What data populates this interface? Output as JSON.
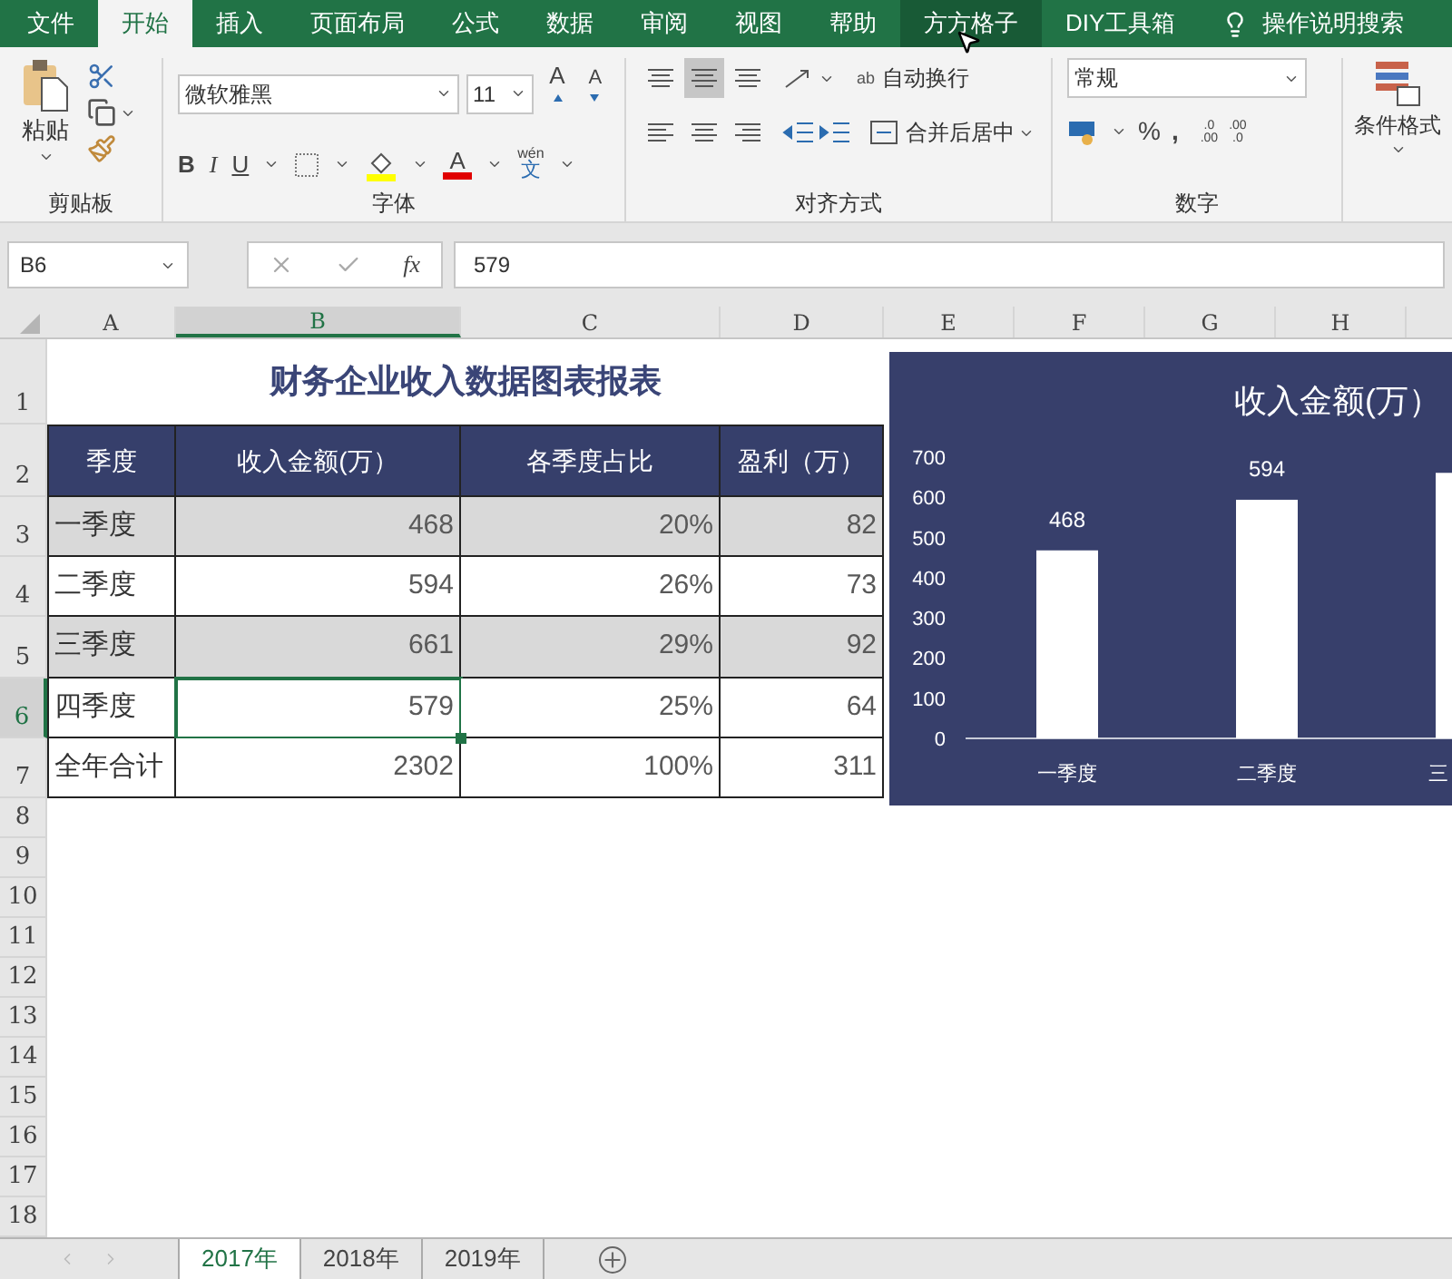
{
  "menu_tabs": [
    {
      "kind": "tab",
      "label": "文件",
      "selected": false,
      "hovered": false
    },
    {
      "kind": "tab",
      "label": "开始",
      "selected": true,
      "hovered": false
    },
    {
      "kind": "tab",
      "label": "插入",
      "selected": false,
      "hovered": false
    },
    {
      "kind": "tab",
      "label": "页面布局",
      "selected": false,
      "hovered": false
    },
    {
      "kind": "tab",
      "label": "公式",
      "selected": false,
      "hovered": false
    },
    {
      "kind": "tab",
      "label": "数据",
      "selected": false,
      "hovered": false
    },
    {
      "kind": "tab",
      "label": "审阅",
      "selected": false,
      "hovered": false
    },
    {
      "kind": "tab",
      "label": "视图",
      "selected": false,
      "hovered": false
    },
    {
      "kind": "tab",
      "label": "帮助",
      "selected": false,
      "hovered": false
    },
    {
      "kind": "tab",
      "label": "方方格子",
      "selected": false,
      "hovered": true
    },
    {
      "kind": "tab",
      "label": "DIY工具箱",
      "selected": false,
      "hovered": false
    },
    {
      "kind": "search",
      "label": "操作说明搜索",
      "selected": false,
      "hovered": false
    }
  ],
  "ribbon": {
    "clipboard": {
      "label": "剪贴板",
      "paste": "粘贴"
    },
    "font": {
      "label": "字体",
      "font_name": "微软雅黑",
      "font_size": "11",
      "grow": "A",
      "shrink": "A",
      "bold": "B",
      "italic": "I",
      "underline": "U",
      "font_color": "A",
      "phonetic_top": "wén",
      "phonetic_bottom": "文"
    },
    "alignment": {
      "label": "对齐方式",
      "vertical": [
        {
          "selected": false
        },
        {
          "selected": true
        },
        {
          "selected": false
        }
      ],
      "horizontal": [
        {
          "selected": false
        },
        {
          "selected": false
        },
        {
          "selected": false
        }
      ],
      "wrap_text": "自动换行",
      "wrap_glyph": "ab",
      "merge_center": "合并后居中"
    },
    "number": {
      "label": "数字",
      "format": "常规",
      "percent": "%",
      "comma": ",",
      "decimal_increase": [
        ".0",
        ".00"
      ],
      "decimal_decrease": [
        ".00",
        ".0"
      ]
    },
    "styles": {
      "conditional_format": "条件格式"
    }
  },
  "formula_bar": {
    "name_box": "B6",
    "fx": "fx",
    "value": "579"
  },
  "columns": [
    {
      "label": "A",
      "selected": false
    },
    {
      "label": "B",
      "selected": true
    },
    {
      "label": "C",
      "selected": false
    },
    {
      "label": "D",
      "selected": false
    },
    {
      "label": "E",
      "selected": false
    },
    {
      "label": "F",
      "selected": false
    },
    {
      "label": "G",
      "selected": false
    },
    {
      "label": "H",
      "selected": false
    }
  ],
  "row_headers": [
    {
      "label": "1",
      "selected": false
    },
    {
      "label": "2",
      "selected": false
    },
    {
      "label": "3",
      "selected": false
    },
    {
      "label": "4",
      "selected": false
    },
    {
      "label": "5",
      "selected": false
    },
    {
      "label": "6",
      "selected": true
    },
    {
      "label": "7",
      "selected": false
    },
    {
      "label": "8",
      "selected": false
    },
    {
      "label": "9",
      "selected": false
    },
    {
      "label": "10",
      "selected": false
    },
    {
      "label": "11",
      "selected": false
    },
    {
      "label": "12",
      "selected": false
    },
    {
      "label": "13",
      "selected": false
    },
    {
      "label": "14",
      "selected": false
    },
    {
      "label": "15",
      "selected": false
    },
    {
      "label": "16",
      "selected": false
    },
    {
      "label": "17",
      "selected": false
    },
    {
      "label": "18",
      "selected": false
    }
  ],
  "sheet": {
    "title": "财务企业收入数据图表报表",
    "header": [
      "季度",
      "收入金额(万）",
      "各季度占比",
      "盈利（万）"
    ],
    "rows": [
      {
        "shaded": true,
        "cells": [
          {
            "text": "一季度",
            "selected": false
          },
          {
            "text": "468",
            "selected": false
          },
          {
            "text": "20%",
            "selected": false
          },
          {
            "text": "82",
            "selected": false
          }
        ]
      },
      {
        "shaded": false,
        "cells": [
          {
            "text": "二季度",
            "selected": false
          },
          {
            "text": "594",
            "selected": false
          },
          {
            "text": "26%",
            "selected": false
          },
          {
            "text": "73",
            "selected": false
          }
        ]
      },
      {
        "shaded": true,
        "cells": [
          {
            "text": "三季度",
            "selected": false
          },
          {
            "text": "661",
            "selected": false
          },
          {
            "text": "29%",
            "selected": false
          },
          {
            "text": "92",
            "selected": false
          }
        ]
      },
      {
        "shaded": false,
        "cells": [
          {
            "text": "四季度",
            "selected": false
          },
          {
            "text": "579",
            "selected": true
          },
          {
            "text": "25%",
            "selected": false
          },
          {
            "text": "64",
            "selected": false
          }
        ]
      },
      {
        "shaded": false,
        "cells": [
          {
            "text": "全年合计",
            "selected": false
          },
          {
            "text": "2302",
            "selected": false
          },
          {
            "text": "100%",
            "selected": false
          },
          {
            "text": "311",
            "selected": false
          }
        ]
      }
    ]
  },
  "chart": {
    "chart_data": {
      "type": "bar",
      "title": "收入金额(万）",
      "categories": [
        "一季度",
        "二季度",
        "三"
      ],
      "values": [
        468,
        594,
        661
      ],
      "value_labels": [
        "468",
        "594",
        null
      ],
      "ylim": [
        0,
        700
      ],
      "yticks": [
        0,
        100,
        200,
        300,
        400,
        500,
        600,
        700
      ]
    }
  },
  "sheet_tabs": [
    {
      "label": "2017年",
      "selected": true
    },
    {
      "label": "2018年",
      "selected": false
    },
    {
      "label": "2019年",
      "selected": false
    }
  ]
}
